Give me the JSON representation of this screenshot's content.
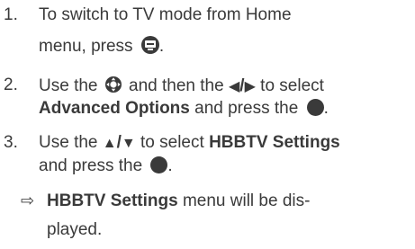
{
  "steps": [
    {
      "number": "1.",
      "line1": "To switch to TV mode from Home",
      "line2_pre": "menu, press ",
      "line2_post": ".",
      "icon": "tv-button-icon"
    },
    {
      "number": "2.",
      "line1_pre": "Use the ",
      "line1_mid": " and then the ",
      "line1_post": " to select",
      "arrow_left": "◀",
      "arrow_sep": "/",
      "arrow_right": "▶",
      "bold_target": "Advanced Options",
      "line2_post": " and press the ",
      "line2_end": ".",
      "icons": [
        "dpad-icon",
        "ok-button-icon"
      ]
    },
    {
      "number": "3.",
      "line1_pre": "Use the ",
      "arrow_up": "▲",
      "arrow_sep": "/",
      "arrow_down": "▼",
      "line1_post": " to select ",
      "bold_target": "HBBTV Settings",
      "line2_pre": "and press the ",
      "line2_end": ".",
      "icons": [
        "ok-button-icon"
      ]
    }
  ],
  "result": {
    "arrow": "⇨",
    "bold": "HBBTV Settings",
    "line1_post": " menu will be dis-",
    "line2": "played."
  }
}
